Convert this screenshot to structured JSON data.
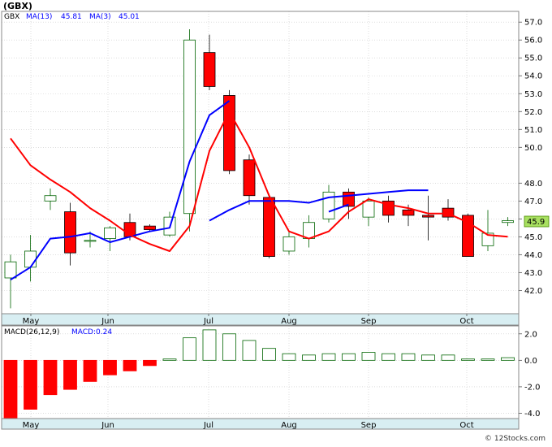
{
  "header": {
    "ticker": "(GBX)",
    "legend_ticker": "GBX",
    "ma13_label": "MA(13)",
    "ma13_value": "45.81",
    "ma3_label": "MA(3)",
    "ma3_value": "45.01"
  },
  "macd_header": {
    "label": "MACD(26,12,9)",
    "value_label": "MACD:0.24"
  },
  "price_tag": "45.9",
  "credit": "© 12Stocks.com",
  "colors": {
    "up": "#006400",
    "down": "#ff0000",
    "ma13": "#0000ff",
    "ma3": "#ff0000",
    "axis_strip": "#d8eef2",
    "price_tag_bg": "#a8e060"
  },
  "chart_data": [
    {
      "type": "candlestick",
      "title": "(GBX)",
      "x_labels": [
        "May",
        "Jun",
        "Jul",
        "Aug",
        "Sep",
        "Oct"
      ],
      "ylim": [
        40.7,
        57.6
      ],
      "y_ticks": [
        42.0,
        43.0,
        44.0,
        45.0,
        46.0,
        47.0,
        48.0,
        50.0,
        51.0,
        52.0,
        53.0,
        54.0,
        55.0,
        56.0,
        57.0
      ],
      "grid": true,
      "ohlc": [
        {
          "o": 42.7,
          "h": 44.0,
          "l": 41.0,
          "c": 43.6
        },
        {
          "o": 43.3,
          "h": 45.1,
          "l": 42.5,
          "c": 44.2
        },
        {
          "o": 47.0,
          "h": 47.7,
          "l": 46.5,
          "c": 47.3
        },
        {
          "o": 46.4,
          "h": 46.9,
          "l": 43.4,
          "c": 44.1
        },
        {
          "o": 44.8,
          "h": 45.3,
          "l": 44.4,
          "c": 44.8
        },
        {
          "o": 44.9,
          "h": 45.6,
          "l": 44.2,
          "c": 45.5
        },
        {
          "o": 45.8,
          "h": 46.3,
          "l": 44.8,
          "c": 45.0
        },
        {
          "o": 45.6,
          "h": 45.7,
          "l": 45.3,
          "c": 45.4
        },
        {
          "o": 45.1,
          "h": 46.4,
          "l": 45.0,
          "c": 46.1
        },
        {
          "o": 46.3,
          "h": 56.6,
          "l": 45.3,
          "c": 56.0
        },
        {
          "o": 55.3,
          "h": 56.3,
          "l": 53.2,
          "c": 53.4
        },
        {
          "o": 52.9,
          "h": 53.2,
          "l": 48.5,
          "c": 48.7
        },
        {
          "o": 49.3,
          "h": 49.6,
          "l": 46.8,
          "c": 47.3
        },
        {
          "o": 47.2,
          "h": 47.4,
          "l": 43.8,
          "c": 43.9
        },
        {
          "o": 44.2,
          "h": 45.3,
          "l": 44.0,
          "c": 45.0
        },
        {
          "o": 44.9,
          "h": 46.2,
          "l": 44.4,
          "c": 45.8
        },
        {
          "o": 46.0,
          "h": 47.9,
          "l": 45.8,
          "c": 47.5
        },
        {
          "o": 47.5,
          "h": 47.7,
          "l": 46.0,
          "c": 46.7
        },
        {
          "o": 46.1,
          "h": 47.2,
          "l": 45.6,
          "c": 47.0
        },
        {
          "o": 47.0,
          "h": 47.3,
          "l": 45.8,
          "c": 46.2
        },
        {
          "o": 46.5,
          "h": 46.8,
          "l": 45.6,
          "c": 46.2
        },
        {
          "o": 46.2,
          "h": 47.3,
          "l": 44.8,
          "c": 46.1
        },
        {
          "o": 46.6,
          "h": 47.1,
          "l": 45.9,
          "c": 46.1
        },
        {
          "o": 46.2,
          "h": 46.3,
          "l": 43.9,
          "c": 43.9
        },
        {
          "o": 44.5,
          "h": 46.5,
          "l": 44.2,
          "c": 45.2
        },
        {
          "o": 45.8,
          "h": 46.1,
          "l": 45.6,
          "c": 45.9
        }
      ],
      "series": [
        {
          "name": "MA(13)",
          "color": "#0000ff",
          "values": [
            42.6,
            43.3,
            44.9,
            45.0,
            45.2,
            44.7,
            45.0,
            45.3,
            45.5,
            49.2,
            51.8,
            52.6,
            null,
            null,
            null,
            null,
            46.4,
            46.8,
            null,
            null,
            null,
            null,
            null,
            null,
            null,
            null
          ]
        },
        {
          "name": "MA(13) tail",
          "color": "#0000ff",
          "values": [
            null,
            null,
            null,
            null,
            null,
            null,
            null,
            null,
            null,
            null,
            45.9,
            46.5,
            47.0,
            47.0,
            47.0,
            46.9,
            47.2,
            47.3,
            47.4,
            47.5,
            47.6,
            47.6,
            null,
            null,
            null,
            null
          ]
        },
        {
          "name": "MA(3)",
          "color": "#ff0000",
          "values": [
            50.5,
            49.0,
            48.2,
            47.5,
            46.6,
            45.9,
            45.1,
            44.6,
            44.2,
            45.6,
            49.8,
            52.0,
            50.0,
            47.3,
            45.3,
            44.9,
            45.3,
            46.4,
            47.1,
            46.8,
            46.6,
            46.3,
            46.3,
            45.8,
            45.1,
            45.0
          ]
        }
      ]
    },
    {
      "type": "bar",
      "title": "MACD(26,12,9)",
      "x_labels": [
        "May",
        "Jun",
        "Jul",
        "Aug",
        "Sep",
        "Oct"
      ],
      "ylim": [
        -4.4,
        2.6
      ],
      "y_ticks": [
        2.0,
        0.0,
        -2.0,
        -4.0
      ],
      "values": [
        -4.4,
        -3.7,
        -2.6,
        -2.2,
        -1.6,
        -1.1,
        -0.8,
        -0.4,
        0.1,
        1.7,
        2.3,
        2.0,
        1.5,
        0.9,
        0.5,
        0.4,
        0.5,
        0.5,
        0.6,
        0.5,
        0.5,
        0.4,
        0.4,
        0.1,
        0.1,
        0.2
      ]
    }
  ]
}
